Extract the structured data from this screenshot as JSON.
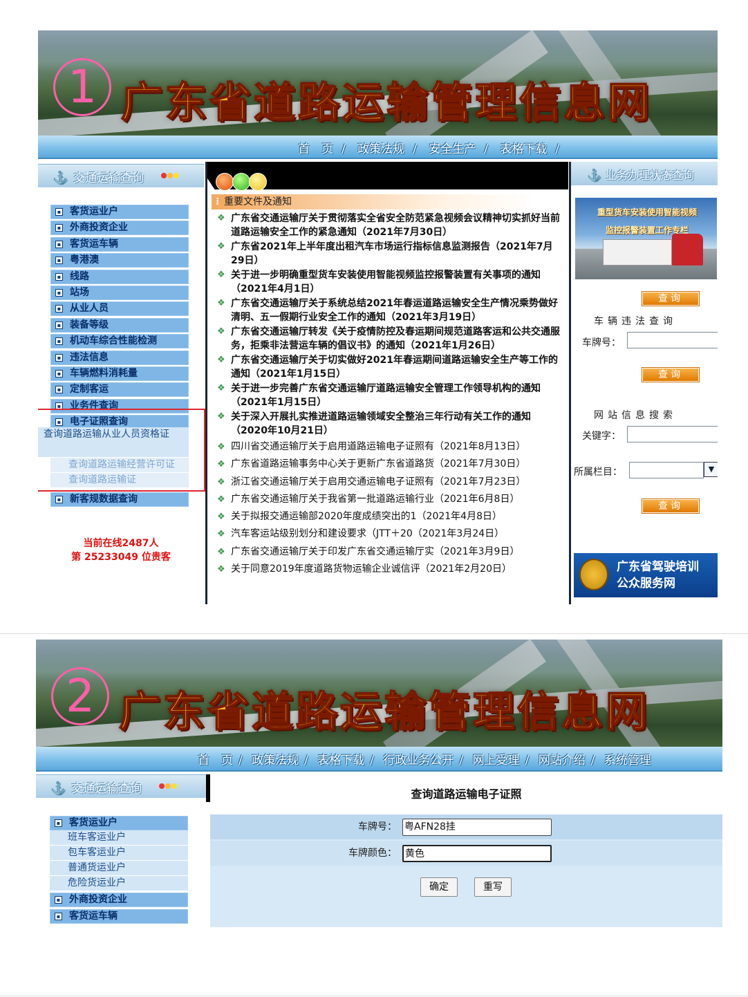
{
  "screenshot1": {
    "marker": "1",
    "site_title": "广东省道路运输管理信息网",
    "nav": [
      "首　页",
      "政策法规",
      "安全生产",
      "表格下载"
    ],
    "nav_separator": "/",
    "left_panel_title": "交通运输查询",
    "menu": [
      "客货运业户",
      "外商投资企业",
      "客货运车辆",
      "粤港澳",
      "线路",
      "站场",
      "从业人员",
      "装备等级",
      "机动车综合性能检测",
      "违法信息",
      "车辆燃料消耗量",
      "定制客运",
      "业务件查询",
      "电子证照查询"
    ],
    "submenu": [
      "查询道路运输从业人员资格证",
      "查询道路运输经营许可证",
      "查询道路运输证"
    ],
    "menu_after": "新客规数据查询",
    "online_line1": "当前在线2487人",
    "online_line2": "第 25233049 位贵客",
    "news_header": "重要文件及通知",
    "news_bold": [
      "广东省交通运输厅关于贯彻落实全省安全防范紧急视频会议精神切实抓好当前道路运输安全工作的紧急通知（2021年7月30日）",
      "广东省2021年上半年度出租汽车市场运行指标信息监测报告（2021年7月29日）",
      "关于进一步明确重型货车安装使用智能视频监控报警装置有关事项的通知（2021年4月1日）",
      "广东省交通运输厅关于系统总结2021年春运道路运输安全生产情况乘势做好清明、五一假期行业安全工作的通知（2021年3月19日）",
      "广东省交通运输厅转发《关于疫情防控及春运期间规范道路客运和公共交通服务，拒乘非法营运车辆的倡议书》的通知（2021年1月26日）",
      "广东省交通运输厅关于切实做好2021年春运期间道路运输安全生产等工作的通知（2021年1月15日）",
      "关于进一步完善广东省交通运输厅道路运输安全管理工作领导机构的通知（2021年1月15日）",
      "关于深入开展扎实推进道路运输领域安全整治三年行动有关工作的通知（2020年10月21日）"
    ],
    "news_normal": [
      "四川省交通运输厅关于启用道路运输电子证照有（2021年8月13日）",
      "广东省道路运输事务中心关于更新广东省道路货（2021年7月30日）",
      "浙江省交通运输厅关于启用交通运输电子证照有（2021年7月23日）",
      "广东省交通运输厅关于我省第一批道路运输行业（2021年6月8日）",
      "关于拟报交通运输部2020年度成绩突出的1（2021年4月8日）",
      "汽车客运站级别划分和建设要求（JTT＋20（2021年3月24日）",
      "广东省交通运输厅关于印发广东省交通运输厅实（2021年3月9日）",
      "关于同意2019年度道路货物运输企业诚信评（2021年2月20日）"
    ],
    "right_panel_title": "业务办理状态查询",
    "truck_banner_line1": "重型货车安装使用智能视频",
    "truck_banner_line2": "监控报警装置工作专栏",
    "query_label": "查询",
    "vehicle_violation_title": "车辆违法查询",
    "plate_label": "车牌号：",
    "site_search_title": "网站信息搜索",
    "keyword_label": "关键字：",
    "column_label": "所属栏目：",
    "driving_banner_line1": "广东省驾驶培训",
    "driving_banner_line2": "公众服务网"
  },
  "screenshot2": {
    "marker": "2",
    "site_title": "广东省道路运输管理信息网",
    "nav": [
      "首　页",
      "政策法规",
      "表格下载",
      "行政业务公开",
      "网上受理",
      "网站介绍",
      "系统管理"
    ],
    "left_panel_title": "交通运输查询",
    "menu_top": "客货运业户",
    "submenu": [
      "班车客运业户",
      "包车客运业户",
      "普通货运业户",
      "危险货运业户"
    ],
    "menu_after": [
      "外商投资企业",
      "客货运车辆"
    ],
    "form_title": "查询道路运输电子证照",
    "plate_label": "车牌号：",
    "plate_value": "粤AFN28挂",
    "color_label": "车牌颜色：",
    "color_value": "黄色",
    "confirm_button": "确定",
    "reset_button": "重写"
  },
  "colors": {
    "title_gold": "#f4b81a",
    "nav_blue": "#7ec0ea",
    "menu_blue": "#7fb6e6",
    "highlight_red": "#e0262e",
    "online_red": "#e01010",
    "query_orange": "#e07a00"
  }
}
